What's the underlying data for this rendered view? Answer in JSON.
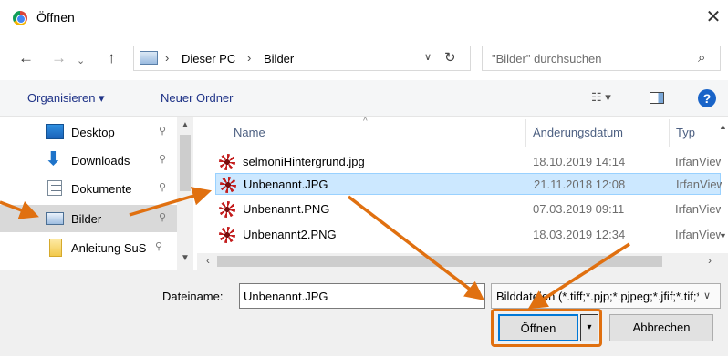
{
  "titlebar": {
    "title": "Öffnen",
    "close": "✕"
  },
  "address": {
    "back": "←",
    "forward": "→",
    "recent": "⌄",
    "up": "↑",
    "crumbs": [
      "Dieser PC",
      "Bilder"
    ],
    "separator": "›",
    "dropdown": "∨",
    "refresh": "↻"
  },
  "search": {
    "placeholder": "\"Bilder\" durchsuchen",
    "icon": "⌕"
  },
  "toolbar": {
    "organize": "Organisieren ▾",
    "new_folder": "Neuer Ordner",
    "view": "☷ ▾",
    "help": "?"
  },
  "sidebar": {
    "items": [
      {
        "label": "Desktop",
        "pin": "📌"
      },
      {
        "label": "Downloads",
        "pin": "📌"
      },
      {
        "label": "Dokumente",
        "pin": "📌"
      },
      {
        "label": "Bilder",
        "pin": "📌"
      },
      {
        "label": "Anleitung SuS",
        "pin": "📌"
      }
    ]
  },
  "filelist": {
    "columns": {
      "name": "Name",
      "date": "Änderungsdatum",
      "type": "Typ"
    },
    "rows": [
      {
        "name": "selmoniHintergrund.jpg",
        "date": "18.10.2019 14:14",
        "type": "IrfanView"
      },
      {
        "name": "Unbenannt.JPG",
        "date": "21.11.2018 12:08",
        "type": "IrfanView"
      },
      {
        "name": "Unbenannt.PNG",
        "date": "07.03.2019 09:11",
        "type": "IrfanView"
      },
      {
        "name": "Unbenannt2.PNG",
        "date": "18.03.2019 12:34",
        "type": "IrfanView"
      }
    ],
    "selected_index": 1
  },
  "bottom": {
    "filename_label": "Dateiname:",
    "filename_value": "Unbenannt.JPG",
    "filter": "Bilddateien (*.tiff;*.pjp;*.pjpeg;*.jfif;*.tif;*.gif)",
    "open": "Öffnen",
    "split": "▾",
    "cancel": "Abbrechen"
  },
  "colors": {
    "annotation": "#e07010",
    "selection": "#cce8ff",
    "link": "#1e3287"
  }
}
